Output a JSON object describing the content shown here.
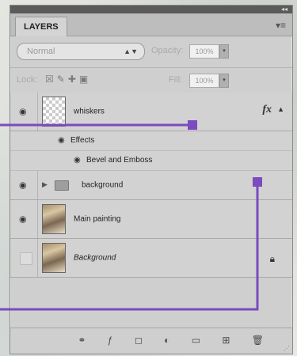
{
  "panel": {
    "tab_label": "LAYERS",
    "menu_icon": "panel-menu-icon"
  },
  "blend": {
    "mode": "Normal",
    "opacity_label": "Opacity:",
    "opacity_value": "100%"
  },
  "lock": {
    "label": "Lock:",
    "fill_label": "Fill:",
    "fill_value": "100%"
  },
  "layers": [
    {
      "name": "whiskers",
      "visible": true,
      "fx": "fx",
      "effects_label": "Effects",
      "effect_items": [
        "Bevel and Emboss"
      ]
    },
    {
      "name": "background",
      "visible": true,
      "type": "group"
    },
    {
      "name": "Main painting",
      "visible": true
    },
    {
      "name": "Background",
      "visible": false,
      "locked": true
    }
  ],
  "bottom": {
    "icons": [
      "link-icon",
      "fx-icon",
      "mask-icon",
      "adjustment-icon",
      "folder-icon",
      "new-layer-icon",
      "trash-icon"
    ],
    "fx_glyph": "fx"
  },
  "colors": {
    "callout": "#7b4bbf",
    "panel": "#cfcfcf"
  }
}
